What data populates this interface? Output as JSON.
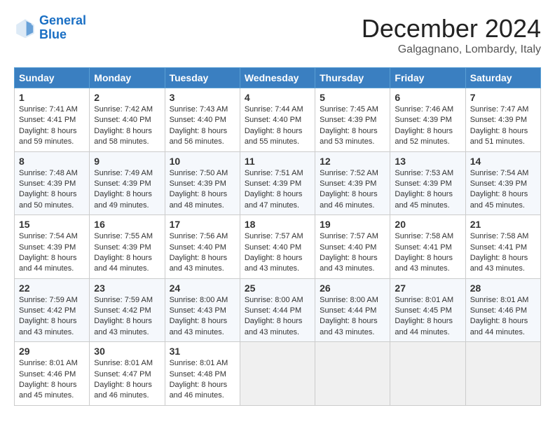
{
  "logo": {
    "line1": "General",
    "line2": "Blue"
  },
  "title": "December 2024",
  "location": "Galgagnano, Lombardy, Italy",
  "days_of_week": [
    "Sunday",
    "Monday",
    "Tuesday",
    "Wednesday",
    "Thursday",
    "Friday",
    "Saturday"
  ],
  "weeks": [
    [
      {
        "day": "1",
        "sunrise": "Sunrise: 7:41 AM",
        "sunset": "Sunset: 4:41 PM",
        "daylight": "Daylight: 8 hours and 59 minutes."
      },
      {
        "day": "2",
        "sunrise": "Sunrise: 7:42 AM",
        "sunset": "Sunset: 4:40 PM",
        "daylight": "Daylight: 8 hours and 58 minutes."
      },
      {
        "day": "3",
        "sunrise": "Sunrise: 7:43 AM",
        "sunset": "Sunset: 4:40 PM",
        "daylight": "Daylight: 8 hours and 56 minutes."
      },
      {
        "day": "4",
        "sunrise": "Sunrise: 7:44 AM",
        "sunset": "Sunset: 4:40 PM",
        "daylight": "Daylight: 8 hours and 55 minutes."
      },
      {
        "day": "5",
        "sunrise": "Sunrise: 7:45 AM",
        "sunset": "Sunset: 4:39 PM",
        "daylight": "Daylight: 8 hours and 53 minutes."
      },
      {
        "day": "6",
        "sunrise": "Sunrise: 7:46 AM",
        "sunset": "Sunset: 4:39 PM",
        "daylight": "Daylight: 8 hours and 52 minutes."
      },
      {
        "day": "7",
        "sunrise": "Sunrise: 7:47 AM",
        "sunset": "Sunset: 4:39 PM",
        "daylight": "Daylight: 8 hours and 51 minutes."
      }
    ],
    [
      {
        "day": "8",
        "sunrise": "Sunrise: 7:48 AM",
        "sunset": "Sunset: 4:39 PM",
        "daylight": "Daylight: 8 hours and 50 minutes."
      },
      {
        "day": "9",
        "sunrise": "Sunrise: 7:49 AM",
        "sunset": "Sunset: 4:39 PM",
        "daylight": "Daylight: 8 hours and 49 minutes."
      },
      {
        "day": "10",
        "sunrise": "Sunrise: 7:50 AM",
        "sunset": "Sunset: 4:39 PM",
        "daylight": "Daylight: 8 hours and 48 minutes."
      },
      {
        "day": "11",
        "sunrise": "Sunrise: 7:51 AM",
        "sunset": "Sunset: 4:39 PM",
        "daylight": "Daylight: 8 hours and 47 minutes."
      },
      {
        "day": "12",
        "sunrise": "Sunrise: 7:52 AM",
        "sunset": "Sunset: 4:39 PM",
        "daylight": "Daylight: 8 hours and 46 minutes."
      },
      {
        "day": "13",
        "sunrise": "Sunrise: 7:53 AM",
        "sunset": "Sunset: 4:39 PM",
        "daylight": "Daylight: 8 hours and 45 minutes."
      },
      {
        "day": "14",
        "sunrise": "Sunrise: 7:54 AM",
        "sunset": "Sunset: 4:39 PM",
        "daylight": "Daylight: 8 hours and 45 minutes."
      }
    ],
    [
      {
        "day": "15",
        "sunrise": "Sunrise: 7:54 AM",
        "sunset": "Sunset: 4:39 PM",
        "daylight": "Daylight: 8 hours and 44 minutes."
      },
      {
        "day": "16",
        "sunrise": "Sunrise: 7:55 AM",
        "sunset": "Sunset: 4:39 PM",
        "daylight": "Daylight: 8 hours and 44 minutes."
      },
      {
        "day": "17",
        "sunrise": "Sunrise: 7:56 AM",
        "sunset": "Sunset: 4:40 PM",
        "daylight": "Daylight: 8 hours and 43 minutes."
      },
      {
        "day": "18",
        "sunrise": "Sunrise: 7:57 AM",
        "sunset": "Sunset: 4:40 PM",
        "daylight": "Daylight: 8 hours and 43 minutes."
      },
      {
        "day": "19",
        "sunrise": "Sunrise: 7:57 AM",
        "sunset": "Sunset: 4:40 PM",
        "daylight": "Daylight: 8 hours and 43 minutes."
      },
      {
        "day": "20",
        "sunrise": "Sunrise: 7:58 AM",
        "sunset": "Sunset: 4:41 PM",
        "daylight": "Daylight: 8 hours and 43 minutes."
      },
      {
        "day": "21",
        "sunrise": "Sunrise: 7:58 AM",
        "sunset": "Sunset: 4:41 PM",
        "daylight": "Daylight: 8 hours and 43 minutes."
      }
    ],
    [
      {
        "day": "22",
        "sunrise": "Sunrise: 7:59 AM",
        "sunset": "Sunset: 4:42 PM",
        "daylight": "Daylight: 8 hours and 43 minutes."
      },
      {
        "day": "23",
        "sunrise": "Sunrise: 7:59 AM",
        "sunset": "Sunset: 4:42 PM",
        "daylight": "Daylight: 8 hours and 43 minutes."
      },
      {
        "day": "24",
        "sunrise": "Sunrise: 8:00 AM",
        "sunset": "Sunset: 4:43 PM",
        "daylight": "Daylight: 8 hours and 43 minutes."
      },
      {
        "day": "25",
        "sunrise": "Sunrise: 8:00 AM",
        "sunset": "Sunset: 4:44 PM",
        "daylight": "Daylight: 8 hours and 43 minutes."
      },
      {
        "day": "26",
        "sunrise": "Sunrise: 8:00 AM",
        "sunset": "Sunset: 4:44 PM",
        "daylight": "Daylight: 8 hours and 43 minutes."
      },
      {
        "day": "27",
        "sunrise": "Sunrise: 8:01 AM",
        "sunset": "Sunset: 4:45 PM",
        "daylight": "Daylight: 8 hours and 44 minutes."
      },
      {
        "day": "28",
        "sunrise": "Sunrise: 8:01 AM",
        "sunset": "Sunset: 4:46 PM",
        "daylight": "Daylight: 8 hours and 44 minutes."
      }
    ],
    [
      {
        "day": "29",
        "sunrise": "Sunrise: 8:01 AM",
        "sunset": "Sunset: 4:46 PM",
        "daylight": "Daylight: 8 hours and 45 minutes."
      },
      {
        "day": "30",
        "sunrise": "Sunrise: 8:01 AM",
        "sunset": "Sunset: 4:47 PM",
        "daylight": "Daylight: 8 hours and 46 minutes."
      },
      {
        "day": "31",
        "sunrise": "Sunrise: 8:01 AM",
        "sunset": "Sunset: 4:48 PM",
        "daylight": "Daylight: 8 hours and 46 minutes."
      },
      null,
      null,
      null,
      null
    ]
  ]
}
